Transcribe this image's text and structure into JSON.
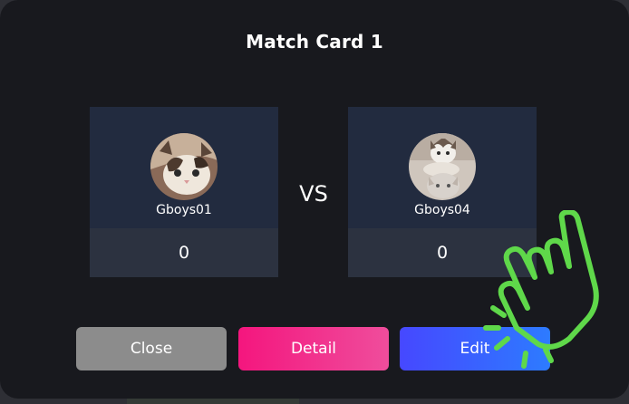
{
  "modal": {
    "title": "Match Card 1",
    "vs_label": "VS"
  },
  "players": [
    {
      "name": "Gboys01",
      "score": "0",
      "avatar": "cat-avatar"
    },
    {
      "name": "Gboys04",
      "score": "0",
      "avatar": "two-cats-avatar"
    }
  ],
  "buttons": {
    "close": "Close",
    "detail": "Detail",
    "edit": "Edit"
  },
  "colors": {
    "modal_bg": "#18191e",
    "card_bg": "#222b3f",
    "score_bg": "#2c3240",
    "close_btn": "#8c8c8c",
    "detail_btn_start": "#f4167e",
    "detail_btn_end": "#ef4d9c",
    "edit_btn_start": "#4648ff",
    "edit_btn_end": "#2d7bff",
    "pointer_hand": "#5fd84a"
  },
  "overlay": {
    "icon": "pointer-hand-icon"
  }
}
